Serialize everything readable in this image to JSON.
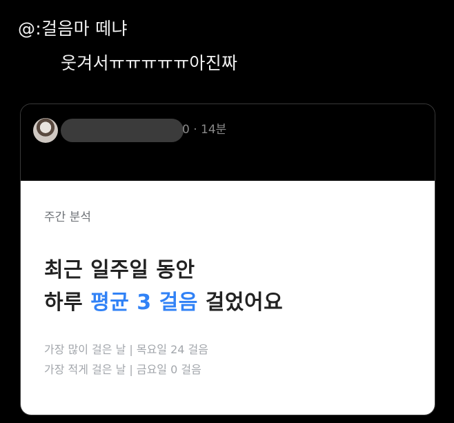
{
  "tweet": {
    "line1": "@:걸음마 떼냐",
    "line2": "웃겨서ㅠㅠㅠㅠㅠ아진짜"
  },
  "quote": {
    "meta": "0 · 14분",
    "card": {
      "label": "주간 분석",
      "headline_line1": "최근 일주일 동안",
      "headline_prefix": "하루 ",
      "headline_highlight": "평균 3 걸음",
      "headline_suffix": " 걸었어요",
      "stat_most": "가장 많이 걸은 날 | 목요일 24 걸음",
      "stat_least": "가장 적게 걸은 날 | 금요일 0 걸음"
    }
  },
  "colors": {
    "accent": "#3182f6",
    "background": "#000000",
    "card": "#ffffff"
  }
}
